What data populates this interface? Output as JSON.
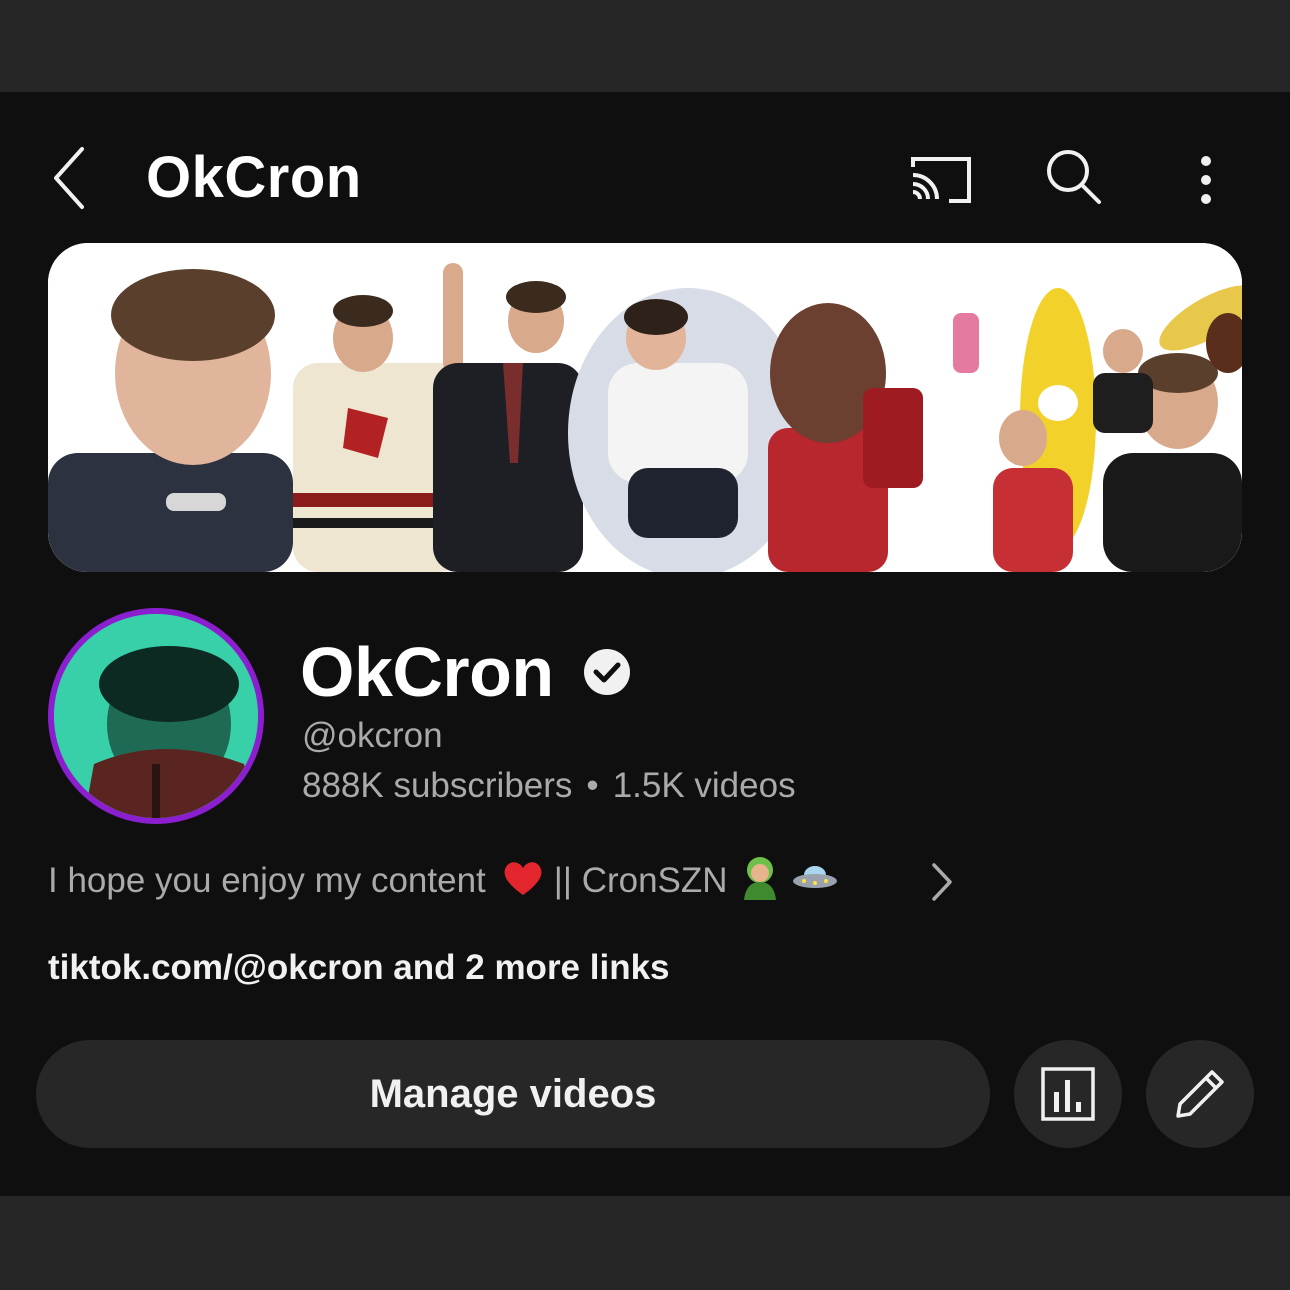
{
  "header": {
    "title": "OkCron",
    "back_icon": "chevron-left-icon",
    "cast_icon": "cast-icon",
    "search_icon": "search-icon",
    "more_icon": "more-vert-icon"
  },
  "banner": {
    "description": "channel-banner-collage"
  },
  "channel": {
    "name": "OkCron",
    "verified_icon": "verified-check-icon",
    "handle": "@okcron",
    "subscribers": "888K subscribers",
    "separator": "•",
    "videos": "1.5K videos",
    "avatar_ring_color": "#8b1fd0"
  },
  "about": {
    "description_part1": "I hope you enjoy my content",
    "description_part2": "|| CronSZN",
    "chevron_icon": "chevron-right-icon",
    "links": "tiktok.com/@okcron and 2 more links"
  },
  "actions": {
    "manage_label": "Manage videos",
    "analytics_icon": "analytics-icon",
    "edit_icon": "pencil-icon"
  },
  "colors": {
    "background": "#0f0f0f",
    "button_bg": "#272727",
    "text_primary": "#f1f1f1",
    "text_secondary": "#aaaaaa"
  }
}
